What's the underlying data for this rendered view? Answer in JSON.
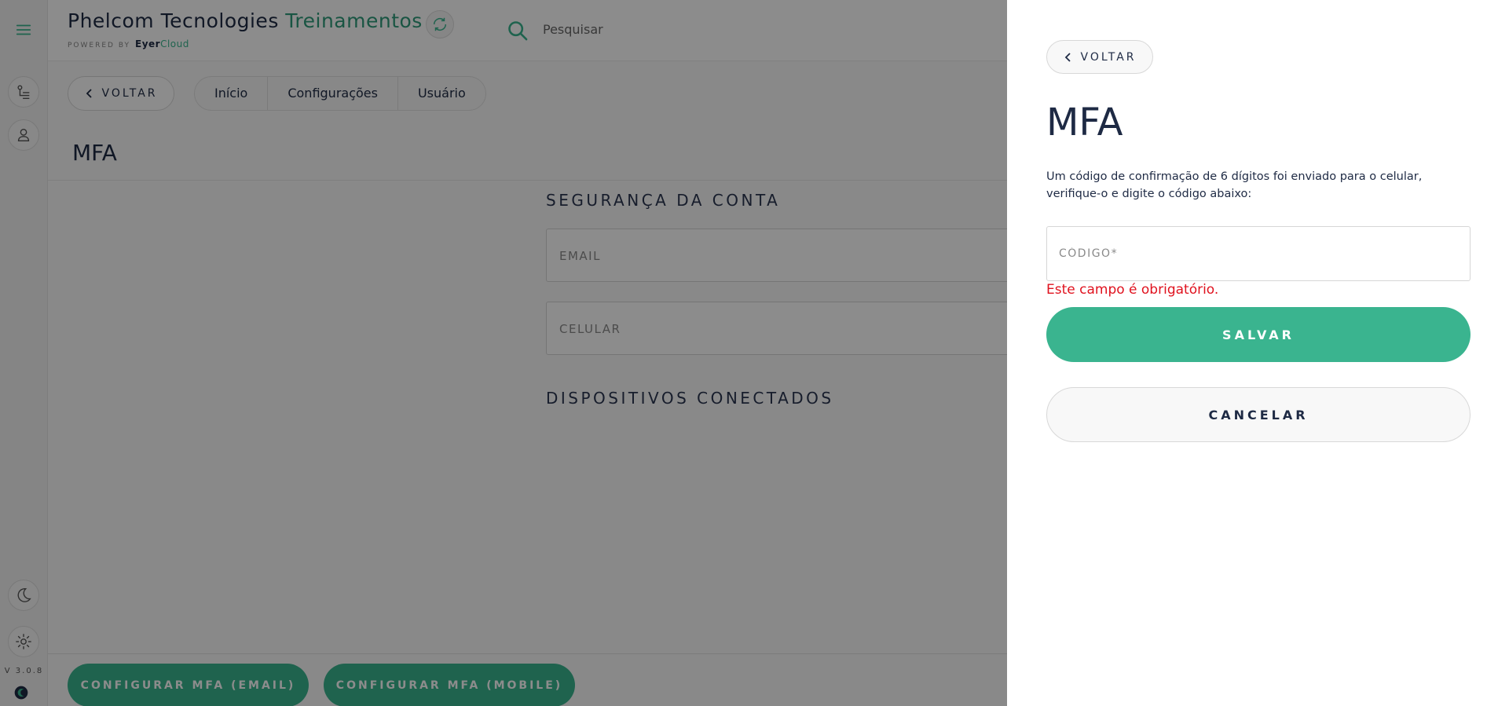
{
  "app": {
    "title_main": "Phelcom Tecnologies",
    "title_accent": "Treinamentos",
    "powered_label": "POWERED BY",
    "powered_brand_1": "Eyer",
    "powered_brand_2": "Cloud",
    "version": "V 3.0.8",
    "accent_color": "#3ab48f",
    "error_color": "#e0121e"
  },
  "search": {
    "placeholder": "Pesquisar",
    "icon": "search-icon"
  },
  "nav": {
    "back_label": "VOLTAR",
    "breadcrumbs": [
      "Início",
      "Configurações",
      "Usuário"
    ]
  },
  "page": {
    "title": "MFA",
    "section_security": "SEGURANÇA DA CONTA",
    "field_email": "EMAIL",
    "field_cellphone": "CELULAR",
    "section_devices": "DISPOSITIVOS CONECTADOS",
    "btn_config_email": "CONFIGURAR MFA (EMAIL)",
    "btn_config_mobile": "CONFIGURAR MFA (MOBILE)"
  },
  "drawer": {
    "back_label": "VOLTAR",
    "title": "MFA",
    "description": "Um código de confirmação de 6 dígitos foi enviado para o celular, verifique-o e digite o código abaixo:",
    "code_placeholder": "CÓDIGO*",
    "code_value": "",
    "error_message": "Este campo é obrigatório.",
    "save_label": "SALVAR",
    "cancel_label": "CANCELAR"
  }
}
